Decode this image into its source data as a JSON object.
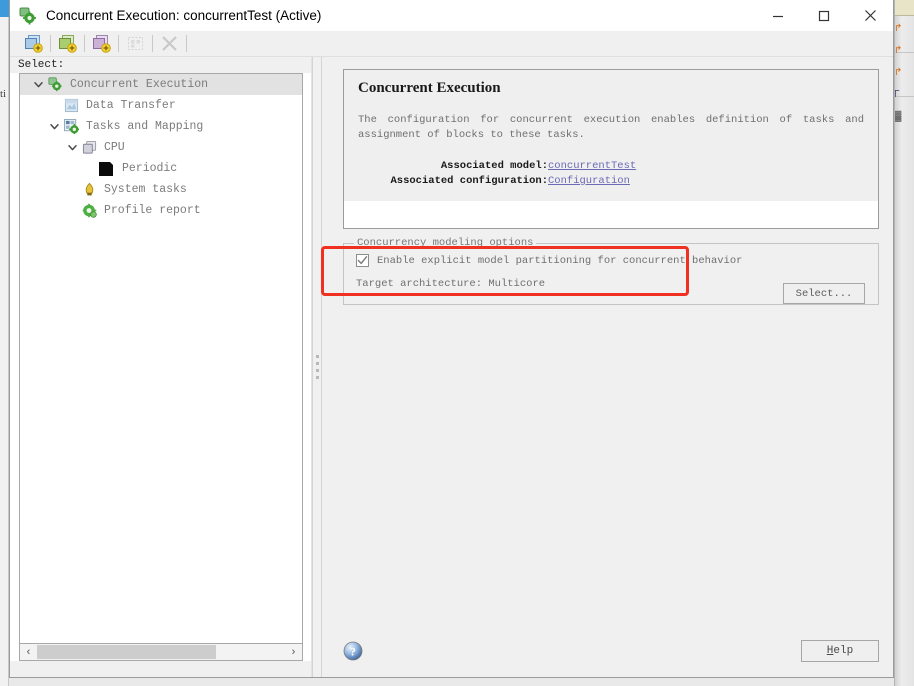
{
  "window": {
    "title": "Concurrent Execution: concurrentTest (Active)",
    "icon": "concurrent-execution-icon",
    "minimize_label": "Minimize",
    "maximize_label": "Maximize",
    "close_label": "Close"
  },
  "toolbar": {
    "buttons": [
      {
        "name": "add-task-button",
        "tooltip": "Add task",
        "enabled": true,
        "color": "#8fb8dd"
      },
      {
        "name": "add-trigger-button",
        "tooltip": "Add trigger",
        "enabled": true,
        "color": "#9fcb6b"
      },
      {
        "name": "add-periodic-trigger-button",
        "tooltip": "Add periodic trigger",
        "enabled": true,
        "color": "#c49ad0"
      },
      {
        "name": "map-blocks-button",
        "tooltip": "Map blocks",
        "enabled": false,
        "color": "#c9c9c9"
      },
      {
        "name": "delete-button",
        "tooltip": "Delete",
        "enabled": false,
        "color": "#c0c0c0"
      }
    ]
  },
  "left_pane": {
    "select_label": "Select:",
    "tree": [
      {
        "label": "Concurrent Execution",
        "icon": "concurrent-execution-icon",
        "depth": 0,
        "expanded": true,
        "selected": true
      },
      {
        "label": "Data Transfer",
        "icon": "data-transfer-icon",
        "depth": 1,
        "expanded": null,
        "selected": false
      },
      {
        "label": "Tasks and Mapping",
        "icon": "tasks-mapping-icon",
        "depth": 1,
        "expanded": true,
        "selected": false
      },
      {
        "label": "CPU",
        "icon": "cpu-icon",
        "depth": 2,
        "expanded": true,
        "selected": false
      },
      {
        "label": "Periodic",
        "icon": "periodic-icon",
        "depth": 3,
        "expanded": null,
        "selected": false
      },
      {
        "label": "System tasks",
        "icon": "system-tasks-icon",
        "depth": 2,
        "expanded": null,
        "selected": false
      },
      {
        "label": "Profile report",
        "icon": "profile-report-icon",
        "depth": 2,
        "expanded": null,
        "selected": false
      }
    ],
    "hscroll": {
      "left_arrow": "‹",
      "right_arrow": "›",
      "thumb_percent": 72
    }
  },
  "description": {
    "title": "Concurrent Execution",
    "body": "The configuration for concurrent execution enables definition of tasks and assignment of blocks to these tasks.",
    "associated_model_label": "Associated model:",
    "associated_model_value": "concurrentTest",
    "associated_configuration_label": "Associated configuration:",
    "associated_configuration_value": "Configuration"
  },
  "options": {
    "group_label": "Concurrency modeling options",
    "checkbox_label": "Enable explicit model partitioning for concurrent behavior",
    "checkbox_checked": true,
    "target_architecture_label": "Target architecture:",
    "target_architecture_value": "Multicore",
    "select_button_label": "Select..."
  },
  "footer": {
    "help_icon": "help-question-icon",
    "help_button_prefix": "H",
    "help_button_rest": "elp"
  },
  "annotation": {
    "type": "rectangle-highlight",
    "color": "#f03020"
  },
  "background_windows": {
    "left_edge_text": "ti",
    "right_edge_glyphs": [
      "↱",
      "↱",
      "↱",
      "Γ",
      "▓"
    ]
  }
}
